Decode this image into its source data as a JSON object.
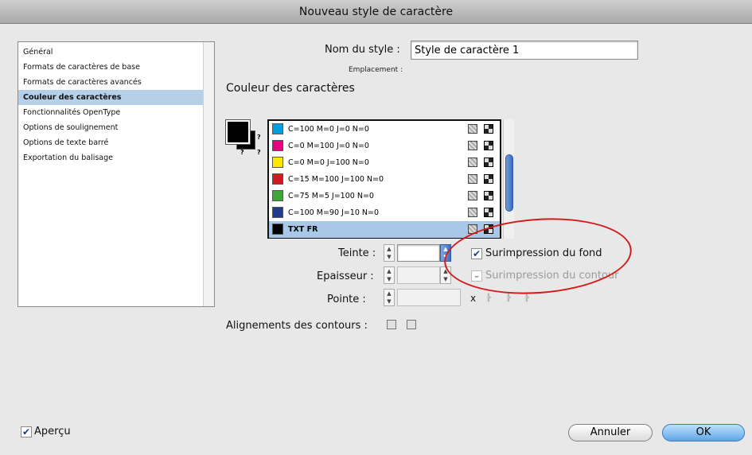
{
  "window": {
    "title": "Nouveau style de caractère"
  },
  "categories": [
    {
      "label": "Général",
      "selected": false
    },
    {
      "label": "Formats de caractères de base",
      "selected": false
    },
    {
      "label": "Formats de caractères avancés",
      "selected": false
    },
    {
      "label": "Couleur des caractères",
      "selected": true
    },
    {
      "label": "Fonctionnalités OpenType",
      "selected": false
    },
    {
      "label": "Options de soulignement",
      "selected": false
    },
    {
      "label": "Options de texte barré",
      "selected": false
    },
    {
      "label": "Exportation du balisage",
      "selected": false
    }
  ],
  "style_name": {
    "label": "Nom du style :",
    "value": "Style de caractère 1"
  },
  "location": {
    "label": "Emplacement :"
  },
  "section_title": "Couleur des caractères",
  "swatch_preview": {
    "q1": "?",
    "q2": "?",
    "q3": "?"
  },
  "swatches": [
    {
      "name": "C=100 M=0 J=0 N=0",
      "color": "#00a0e0",
      "selected": false
    },
    {
      "name": "C=0 M=100 J=0 N=0",
      "color": "#e3007f",
      "selected": false
    },
    {
      "name": "C=0 M=0 J=100 N=0",
      "color": "#ffe800",
      "selected": false
    },
    {
      "name": "C=15 M=100 J=100 N=0",
      "color": "#d11a1f",
      "selected": false
    },
    {
      "name": "C=75 M=5 J=100 N=0",
      "color": "#3ea63b",
      "selected": false
    },
    {
      "name": "C=100 M=90 J=10 N=0",
      "color": "#1f3c8e",
      "selected": false
    },
    {
      "name": "TXT FR",
      "color": "#000000",
      "selected": true
    }
  ],
  "tint": {
    "label": "Teinte :",
    "value": ""
  },
  "weight": {
    "label": "Epaisseur :",
    "value": ""
  },
  "point": {
    "label": "Pointe :",
    "value": "",
    "x": "x"
  },
  "overprint_fill": {
    "label": "Surimpression du fond",
    "checked": "✔"
  },
  "overprint_stroke": {
    "label": "Surimpression du contour",
    "checked": "–"
  },
  "stroke_align": {
    "label": "Alignements des contours :"
  },
  "preview": {
    "label": "Aperçu",
    "checked": "✔"
  },
  "buttons": {
    "cancel": "Annuler",
    "ok": "OK"
  },
  "colors": {
    "selection": "#a9c8e8",
    "annotation": "#d21b1b",
    "accent": "#3c6fc0"
  }
}
